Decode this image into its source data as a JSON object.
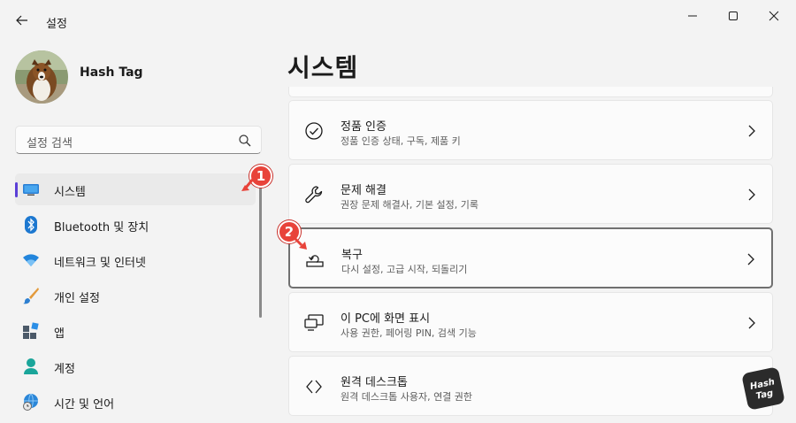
{
  "window": {
    "app_title": "설정"
  },
  "profile": {
    "user_name": "Hash Tag"
  },
  "search": {
    "placeholder": "설정 검색"
  },
  "sidebar": {
    "items": [
      {
        "label": "시스템",
        "icon": "system-monitor-icon",
        "selected": true
      },
      {
        "label": "Bluetooth 및 장치",
        "icon": "bluetooth-icon"
      },
      {
        "label": "네트워크 및 인터넷",
        "icon": "wifi-icon"
      },
      {
        "label": "개인 설정",
        "icon": "paintbrush-icon"
      },
      {
        "label": "앱",
        "icon": "apps-icon"
      },
      {
        "label": "계정",
        "icon": "account-icon"
      },
      {
        "label": "시간 및 언어",
        "icon": "globe-clock-icon"
      }
    ]
  },
  "main": {
    "page_title": "시스템",
    "cards": [
      {
        "title": "정품 인증",
        "desc": "정품 인증 상태, 구독, 제품 키",
        "icon": "check-circle-icon"
      },
      {
        "title": "문제 해결",
        "desc": "권장 문제 해결사, 기본 설정, 기록",
        "icon": "wrench-icon"
      },
      {
        "title": "복구",
        "desc": "다시 설정, 고급 시작, 되돌리기",
        "icon": "recovery-icon",
        "highlighted": true
      },
      {
        "title": "이 PC에 화면 표시",
        "desc": "사용 권한, 페어링 PIN, 검색 기능",
        "icon": "project-screen-icon"
      },
      {
        "title": "원격 데스크톱",
        "desc": "원격 데스크톱 사용자, 연결 권한",
        "icon": "remote-desktop-icon"
      }
    ]
  },
  "annotations": {
    "badge_1": "1",
    "badge_2": "2",
    "color": "#e8433a"
  },
  "colors": {
    "accent": "#5b3fd7",
    "background": "#f3f3f3",
    "card": "#fbfbfb"
  }
}
